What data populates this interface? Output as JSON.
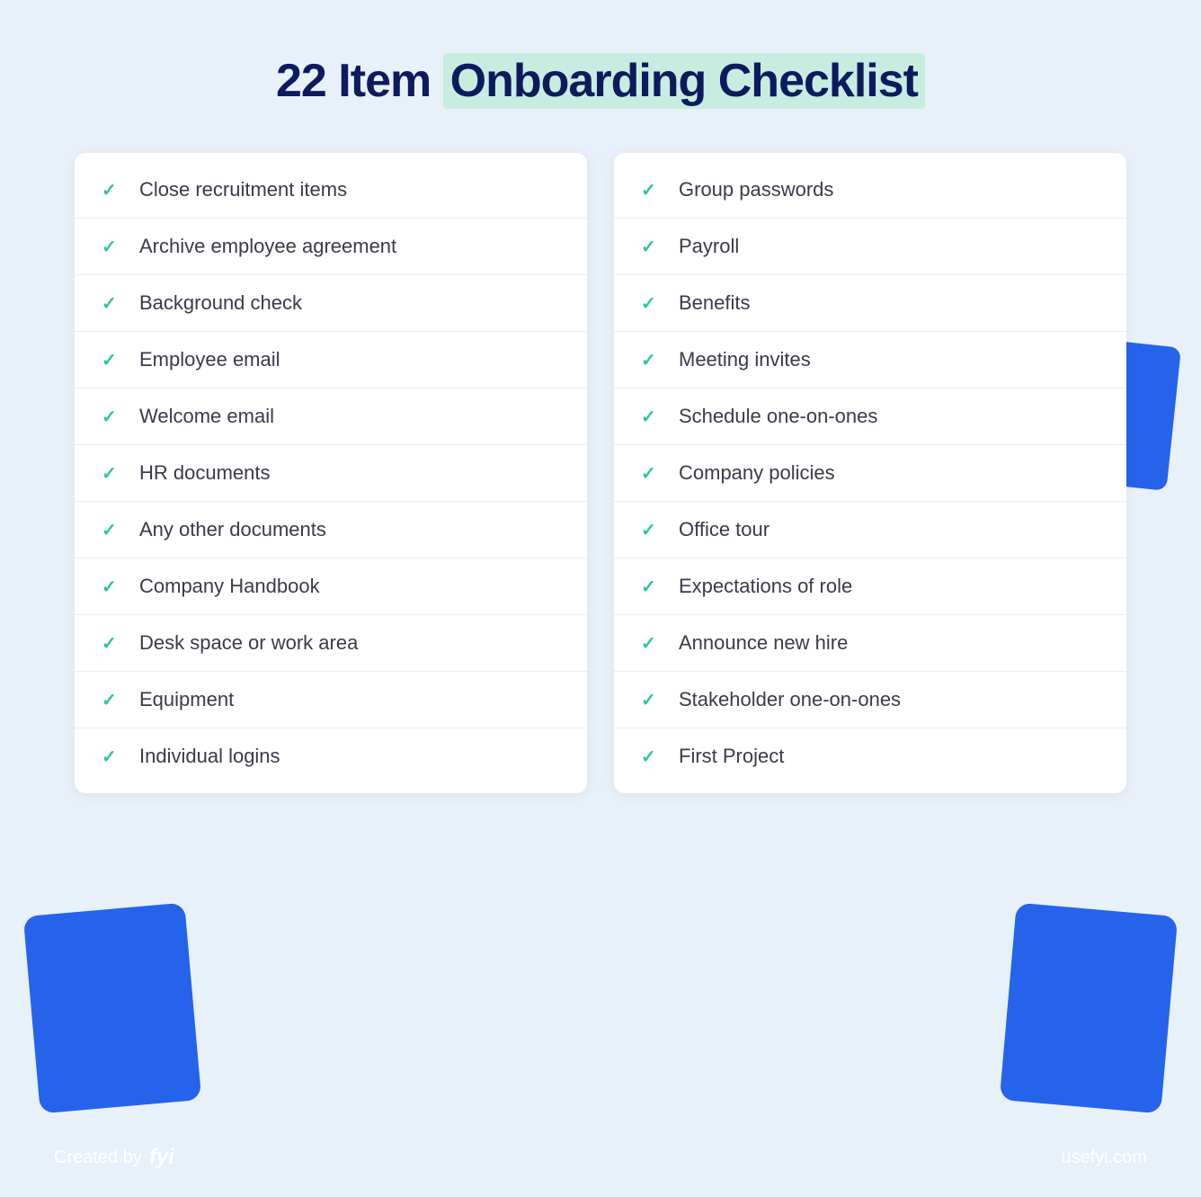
{
  "header": {
    "title_part1": "22 Item ",
    "title_part2": "Onboarding Checklist"
  },
  "left_items": [
    "Close recruitment items",
    "Archive employee agreement",
    "Background check",
    "Employee email",
    "Welcome email",
    "HR documents",
    "Any other documents",
    "Company Handbook",
    "Desk space or work area",
    "Equipment",
    "Individual logins"
  ],
  "right_items": [
    "Group passwords",
    "Payroll",
    "Benefits",
    "Meeting invites",
    "Schedule one-on-ones",
    "Company policies",
    "Office tour",
    "Expectations of role",
    "Announce new hire",
    "Stakeholder one-on-ones",
    "First Project"
  ],
  "footer": {
    "created_by": "Created by",
    "brand": "fyi",
    "website": "usefyi.com"
  },
  "check_symbol": "✓"
}
